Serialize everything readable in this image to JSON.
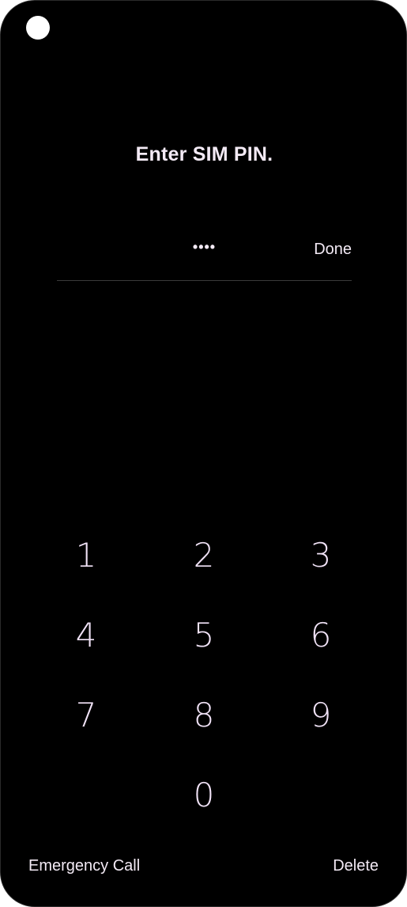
{
  "prompt": {
    "title": "Enter SIM PIN."
  },
  "pin_input": {
    "masked_value": "••••",
    "done_label": "Done"
  },
  "keypad": {
    "keys": [
      "1",
      "2",
      "3",
      "4",
      "5",
      "6",
      "7",
      "8",
      "9",
      "0"
    ]
  },
  "footer": {
    "emergency_label": "Emergency Call",
    "delete_label": "Delete"
  },
  "colors": {
    "background": "#000000",
    "text": "#f3eaf5",
    "digit": "#f0e2f6"
  }
}
